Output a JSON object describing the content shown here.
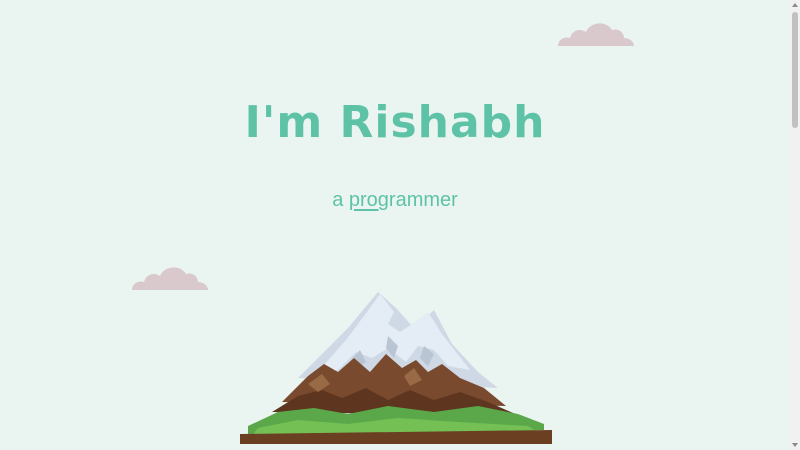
{
  "hero": {
    "title": "I'm Rishabh",
    "subtitle_prefix": "a ",
    "subtitle_typed": "prog",
    "subtitle_rest": "rammer"
  },
  "colors": {
    "background": "#eaf5f1",
    "accent": "#5ec3a6",
    "cloud": "#d9c9cc",
    "snow": "#dfe8f3",
    "rock": "#7a4a2e",
    "grass": "#5aa84a"
  },
  "icons": {
    "cloud": "cloud-icon",
    "mountain": "mountain-illustration"
  }
}
